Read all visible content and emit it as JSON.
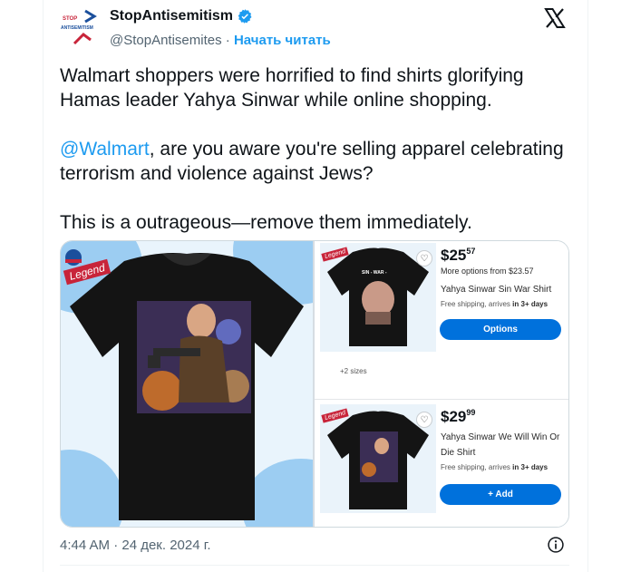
{
  "header": {
    "display_name": "StopAntisemitism",
    "handle": "@StopAntisemites",
    "separator": "·",
    "follow_label": "Начать читать",
    "avatar_text_top": "STOP",
    "avatar_text_bottom": "ANTISEMITISM",
    "verified": true,
    "icons": [
      "verified-badge-icon",
      "x-logo-icon"
    ]
  },
  "tweet": {
    "paragraph1": "Walmart shoppers were horrified to find shirts glorifying Hamas leader Yahya Sinwar while online shopping.",
    "mention": "@Walmart",
    "paragraph2_rest": ", are you aware you're selling apparel celebrating terrorism and violence against Jews?",
    "paragraph3": "This is a outrageous—remove them immediately."
  },
  "media": {
    "main_shirt_legend": "Legend",
    "products": [
      {
        "price_dollars": "$25",
        "price_cents": "57",
        "more_options": "More options from $23.57",
        "name": "Yahya Sinwar Sin War Shirt",
        "shipping_prefix": "Free shipping, arrives ",
        "shipping_bold": "in 3+ days",
        "button_label": "Options",
        "sizes": "+2 sizes",
        "shirt_text": "SIN - WAR -",
        "legend": "Legend"
      },
      {
        "price_dollars": "$29",
        "price_cents": "99",
        "name_line1": "Yahya Sinwar We Will Win Or",
        "name_line2": "Die Shirt",
        "shipping_prefix": "Free shipping, arrives ",
        "shipping_bold": "in 3+ days",
        "button_label": "+ Add",
        "legend": "Legend"
      }
    ]
  },
  "footer": {
    "timestamp": "4:44 AM · 24 дек. 2024 г.",
    "icons": [
      "info-icon"
    ]
  },
  "colors": {
    "link": "#1d9bf0",
    "walmart_blue": "#0071dc",
    "muted": "#536471"
  }
}
